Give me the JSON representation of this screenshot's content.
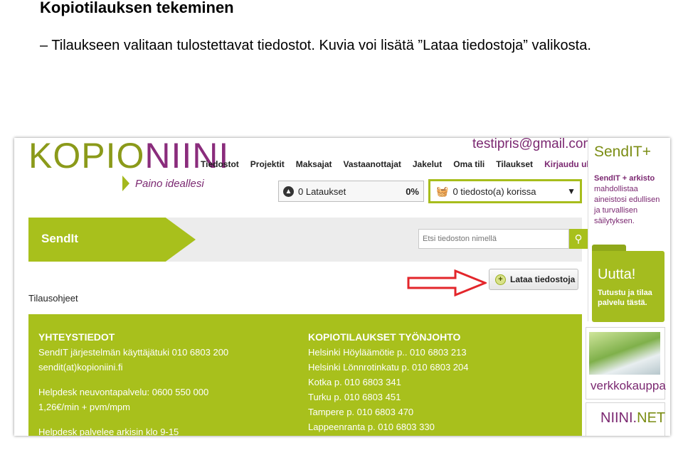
{
  "slide": {
    "title": "Kopiotilauksen tekeminen",
    "bullet": "– Tilaukseen valitaan tulostettavat tiedostot. Kuvia voi lisätä ”Lataa tiedostoja” valikosta."
  },
  "header": {
    "logo_part1": "KOPIO",
    "logo_part2": "NIINI",
    "tagline": "Paino ideallesi",
    "user_email": "testipris@gmail.com",
    "nav": [
      "Tiedostot",
      "Projektit",
      "Maksajat",
      "Vastaanottajat",
      "Jakelut",
      "Oma tili",
      "Tilaukset"
    ],
    "logout": "Kirjaudu ulos",
    "uploads_label": "0 Lataukset",
    "uploads_percent": "0%",
    "cart_label": "0 tiedosto(a) korissa"
  },
  "banner": {
    "title": "SendIt",
    "search_placeholder": "Etsi tiedoston nimellä"
  },
  "actions": {
    "upload_button": "Lataa tiedostoja"
  },
  "order_guide": "Tilausohjeet",
  "contact": {
    "left_head": "YHTEYSTIEDOT",
    "left_lines": [
      "SendIT järjestelmän käyttäjätuki 010 6803 200",
      "sendit(at)kopioniini.fi"
    ],
    "left_lines2": [
      "Helpdesk neuvontapalvelu: 0600 550 000",
      "1,26€/min + pvm/mpm"
    ],
    "left_lines3": [
      "Helpdesk palvelee arkisin klo 9-15"
    ],
    "right_head": "KOPIOTILAUKSET TYÖNJOHTO",
    "right_lines": [
      "Helsinki Höyläämötie p.. 010 6803 213",
      "Helsinki Lönnrotinkatu p. 010 6803 204",
      "Kotka p. 010 6803 341",
      "Turku p. 010 6803 451",
      "Tampere p. 010 6803 470",
      "Lappeenranta p. 010 6803 330"
    ]
  },
  "sidebar": {
    "sendit_plus": "SendIT+",
    "sendit_text_bold": "SendIT + arkisto",
    "sendit_text": "mahdollistaa aineistosi edullisen ja turvallisen säilytyksen.",
    "uutta": "Uutta!",
    "uutta_sub": "Tutustu ja tilaa palvelu tästä.",
    "shop": "verkkokauppa",
    "niini": "NIINI.",
    "niini_net": "NET"
  },
  "colors": {
    "brand_green": "#a8c01c",
    "brand_purple": "#7b2871",
    "arrow_red": "#e3262b"
  }
}
